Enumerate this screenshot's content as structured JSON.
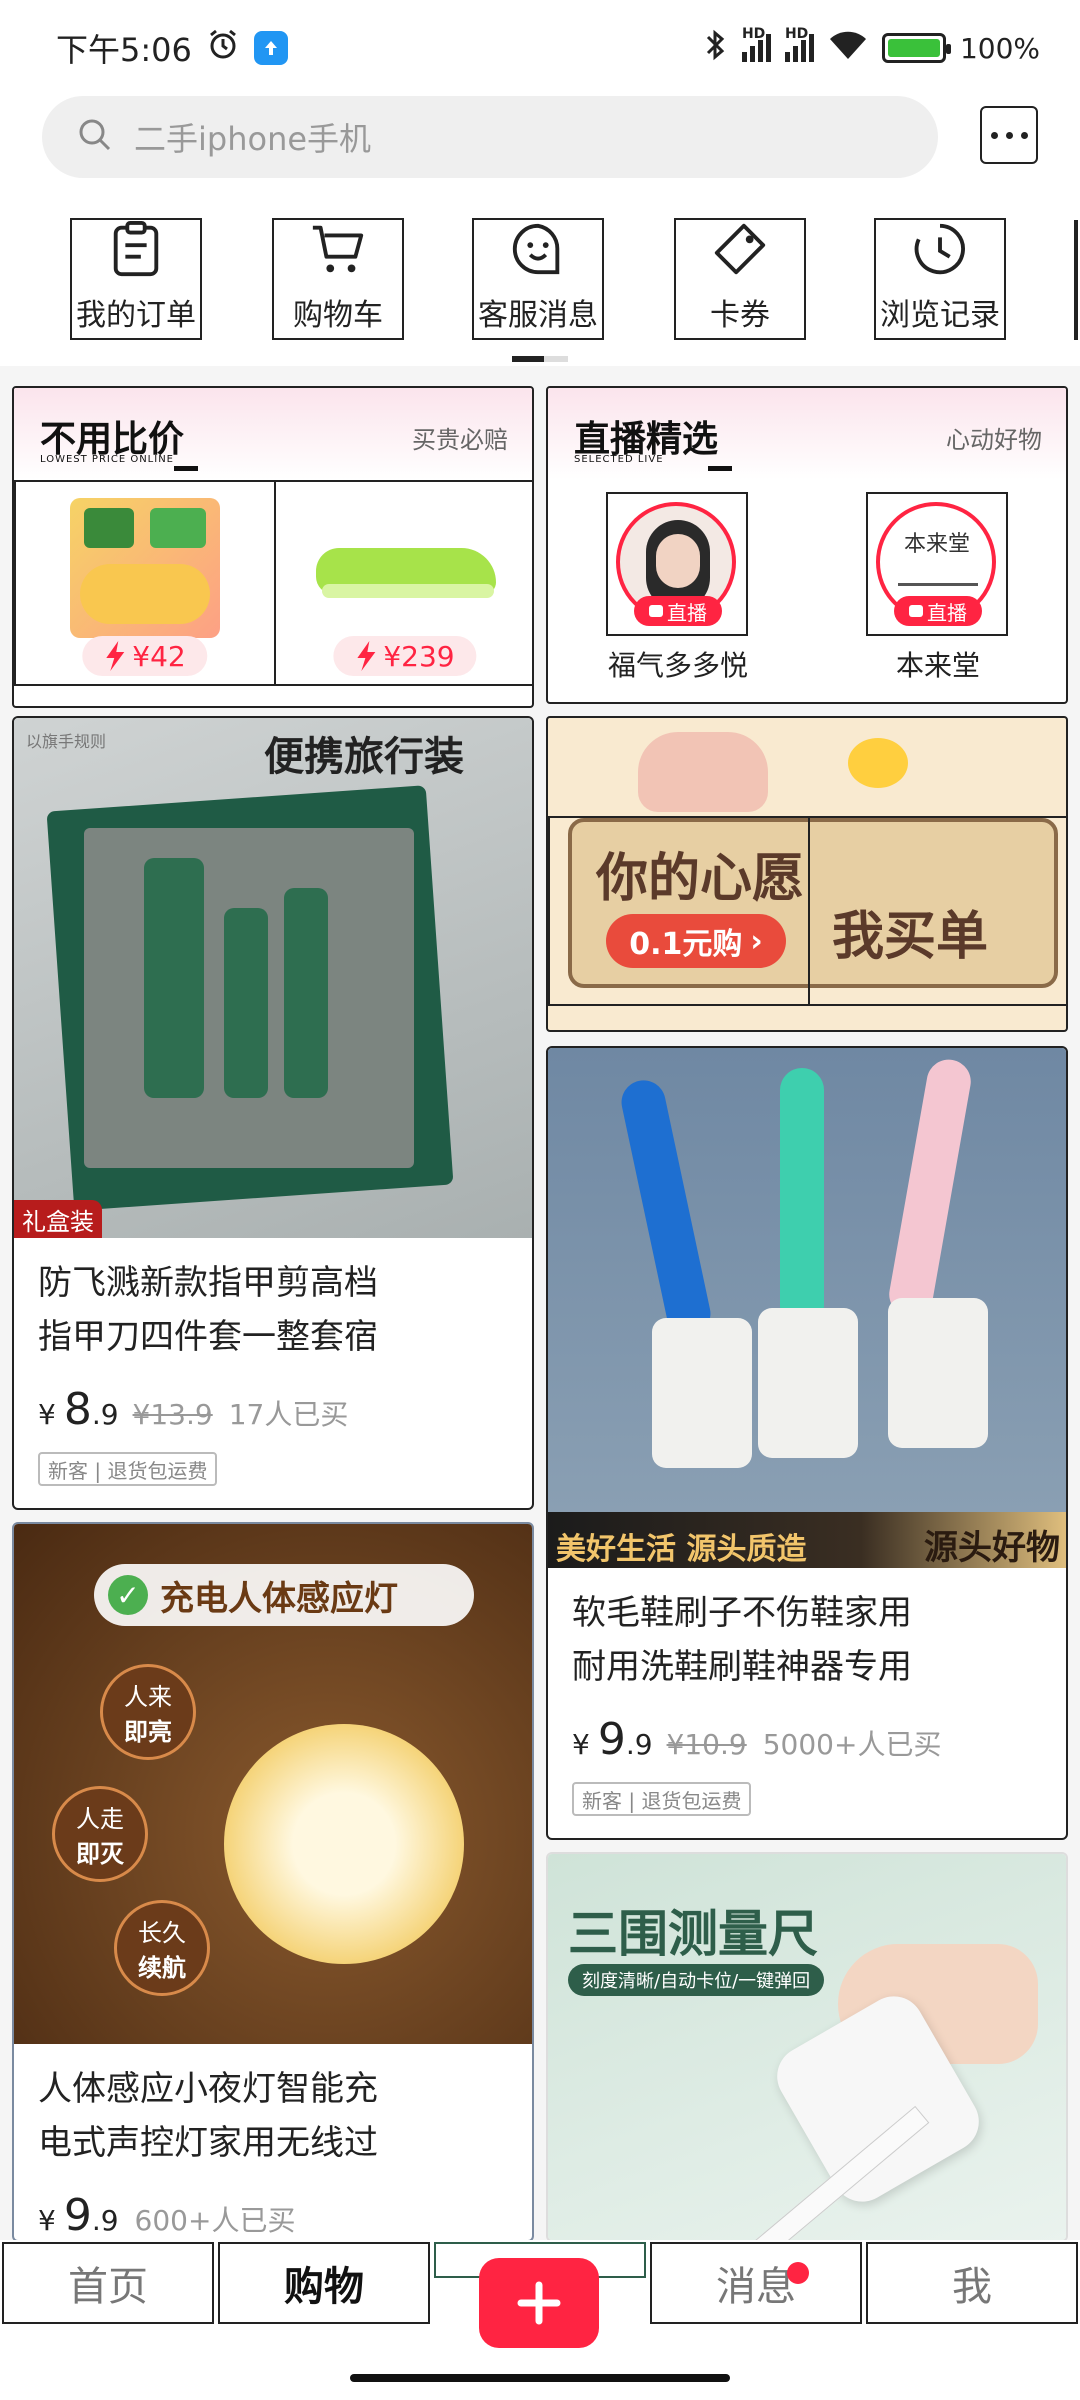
{
  "status_bar": {
    "time": "下午5:06",
    "battery": "100%",
    "net1": "HD",
    "net2": "HD",
    "battery_level": 1.0
  },
  "search": {
    "placeholder": "二手iphone手机"
  },
  "shortcuts": [
    {
      "label": "我的订单",
      "icon": "order-icon"
    },
    {
      "label": "购物车",
      "icon": "cart-icon"
    },
    {
      "label": "客服消息",
      "icon": "chat-icon"
    },
    {
      "label": "卡券",
      "icon": "coupon-icon"
    },
    {
      "label": "浏览记录",
      "icon": "history-icon"
    }
  ],
  "low_price": {
    "title": "不用比价",
    "subtitle": "LOWEST PRICE ONLINE",
    "tagline": "买贵必赔",
    "products": [
      {
        "price": "¥42",
        "image": "snack-bag"
      },
      {
        "price": "¥239",
        "image": "green-shoe"
      }
    ]
  },
  "live": {
    "title": "直播精选",
    "subtitle": "SELECTED LIVE",
    "tagline": "心动好物",
    "badge": "直播",
    "streamers": [
      {
        "name": "福气多多悦"
      },
      {
        "name": "本来堂"
      }
    ]
  },
  "feed": {
    "nail": {
      "banner": "便携旅行装",
      "watermark": "以旗手规则",
      "corner_tag": "礼盒装",
      "title_line1": "防飞溅新款指甲剪高档",
      "title_line2": "指甲刀四件套一整套宿",
      "currency": "¥",
      "price_int": "8",
      "price_dec": ".9",
      "original": "¥13.9",
      "sold": "17人已买",
      "badges": "新客 | 退货包运费"
    },
    "promo": {
      "line1": "你的心愿",
      "line2": "我买单",
      "button": "0.1元购"
    },
    "brush": {
      "banner_left": "美好生活 源头质造",
      "banner_right": "源头好物",
      "title_line1": "软毛鞋刷子不伤鞋家用",
      "title_line2": "耐用洗鞋刷鞋神器专用",
      "currency": "¥",
      "price_int": "9",
      "price_dec": ".9",
      "original": "¥10.9",
      "sold": "5000+人已买",
      "badges": "新客 | 退货包运费"
    },
    "lamp": {
      "headline": "充电人体感应灯",
      "bubble1a": "人来",
      "bubble1b": "即亮",
      "bubble2a": "人走",
      "bubble2b": "即灭",
      "bubble3a": "长久",
      "bubble3b": "续航",
      "title_line1": "人体感应小夜灯智能充",
      "title_line2": "电式声控灯家用无线过",
      "currency": "¥",
      "price_int": "9",
      "price_dec": ".9",
      "sold": "600+人已买"
    },
    "tape": {
      "headline": "三围测量尺",
      "subline": "刻度清晰/自动卡位/一键弹回"
    }
  },
  "nav": {
    "home": "首页",
    "shop": "购物",
    "messages": "消息",
    "me": "我"
  },
  "colors": {
    "accent": "#ff2442",
    "brand_red": "#ff2442"
  }
}
